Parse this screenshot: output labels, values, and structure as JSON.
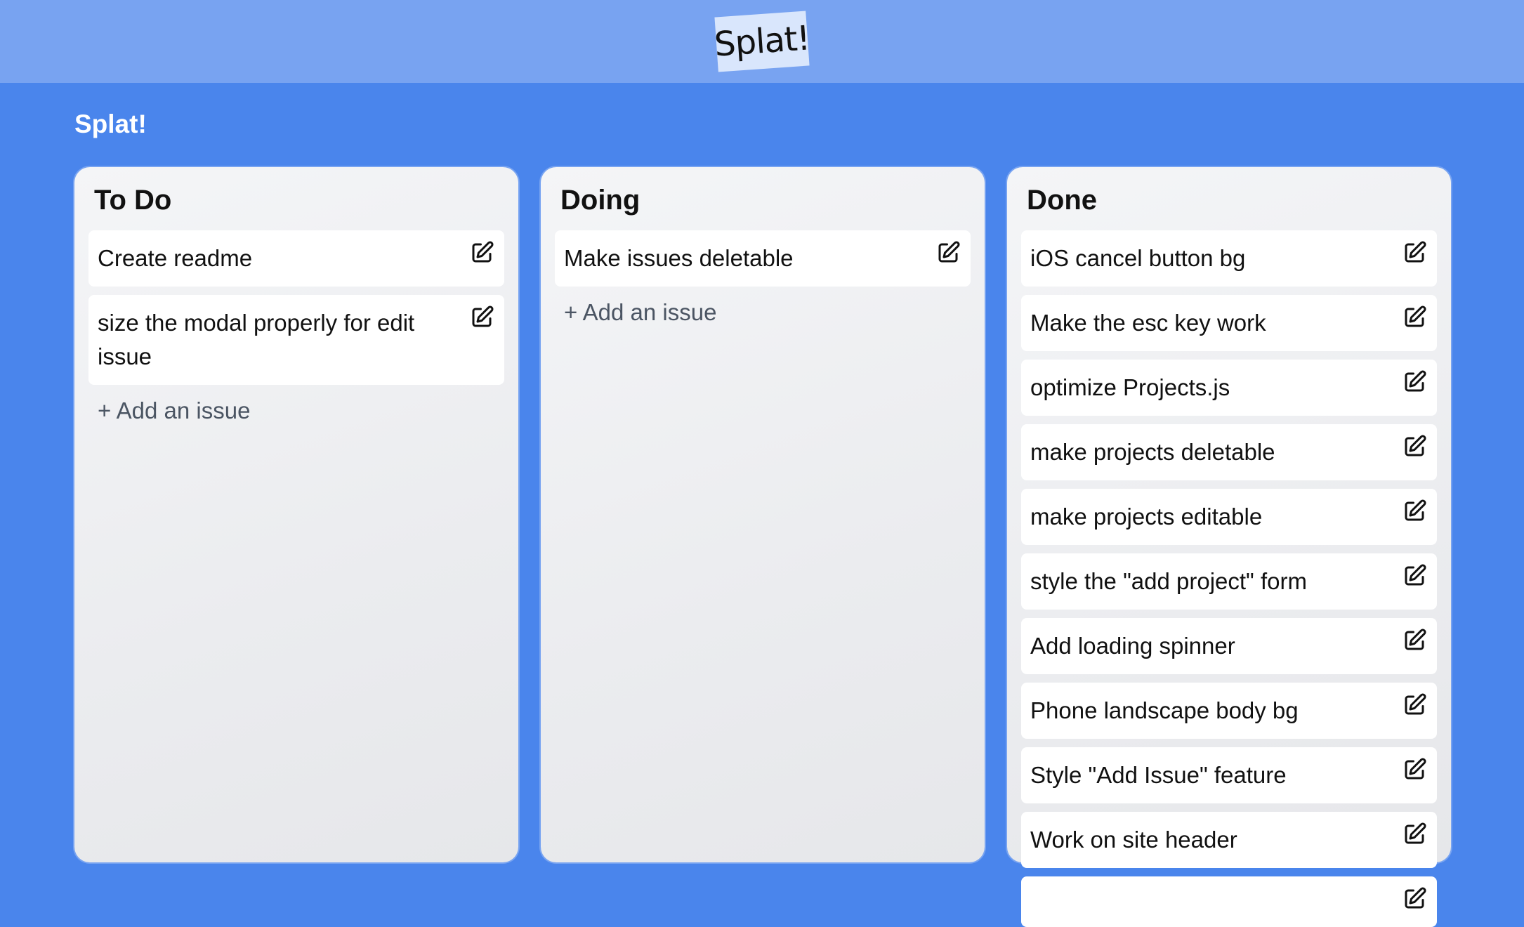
{
  "header": {
    "logo_text": "Splat!"
  },
  "page": {
    "title": "Splat!"
  },
  "columns": [
    {
      "title": "To Do",
      "add_label": "+ Add an issue",
      "cards": [
        "Create readme",
        "size the modal properly for edit issue"
      ]
    },
    {
      "title": "Doing",
      "add_label": "+ Add an issue",
      "cards": [
        "Make issues deletable"
      ]
    },
    {
      "title": "Done",
      "cards": [
        "iOS cancel button bg",
        "Make the esc key work",
        "optimize Projects.js",
        "make projects deletable",
        "make projects editable",
        "style the \"add project\" form",
        "Add loading spinner",
        "Phone landscape body bg",
        "Style \"Add Issue\" feature",
        "Work on site header",
        ""
      ]
    }
  ],
  "icons": {
    "edit": "edit-icon"
  },
  "colors": {
    "background": "#4a85ec",
    "topbar": "#78a3f1",
    "logo_badge": "#d9e6fc",
    "column": "#eeeff2",
    "card": "#ffffff"
  }
}
